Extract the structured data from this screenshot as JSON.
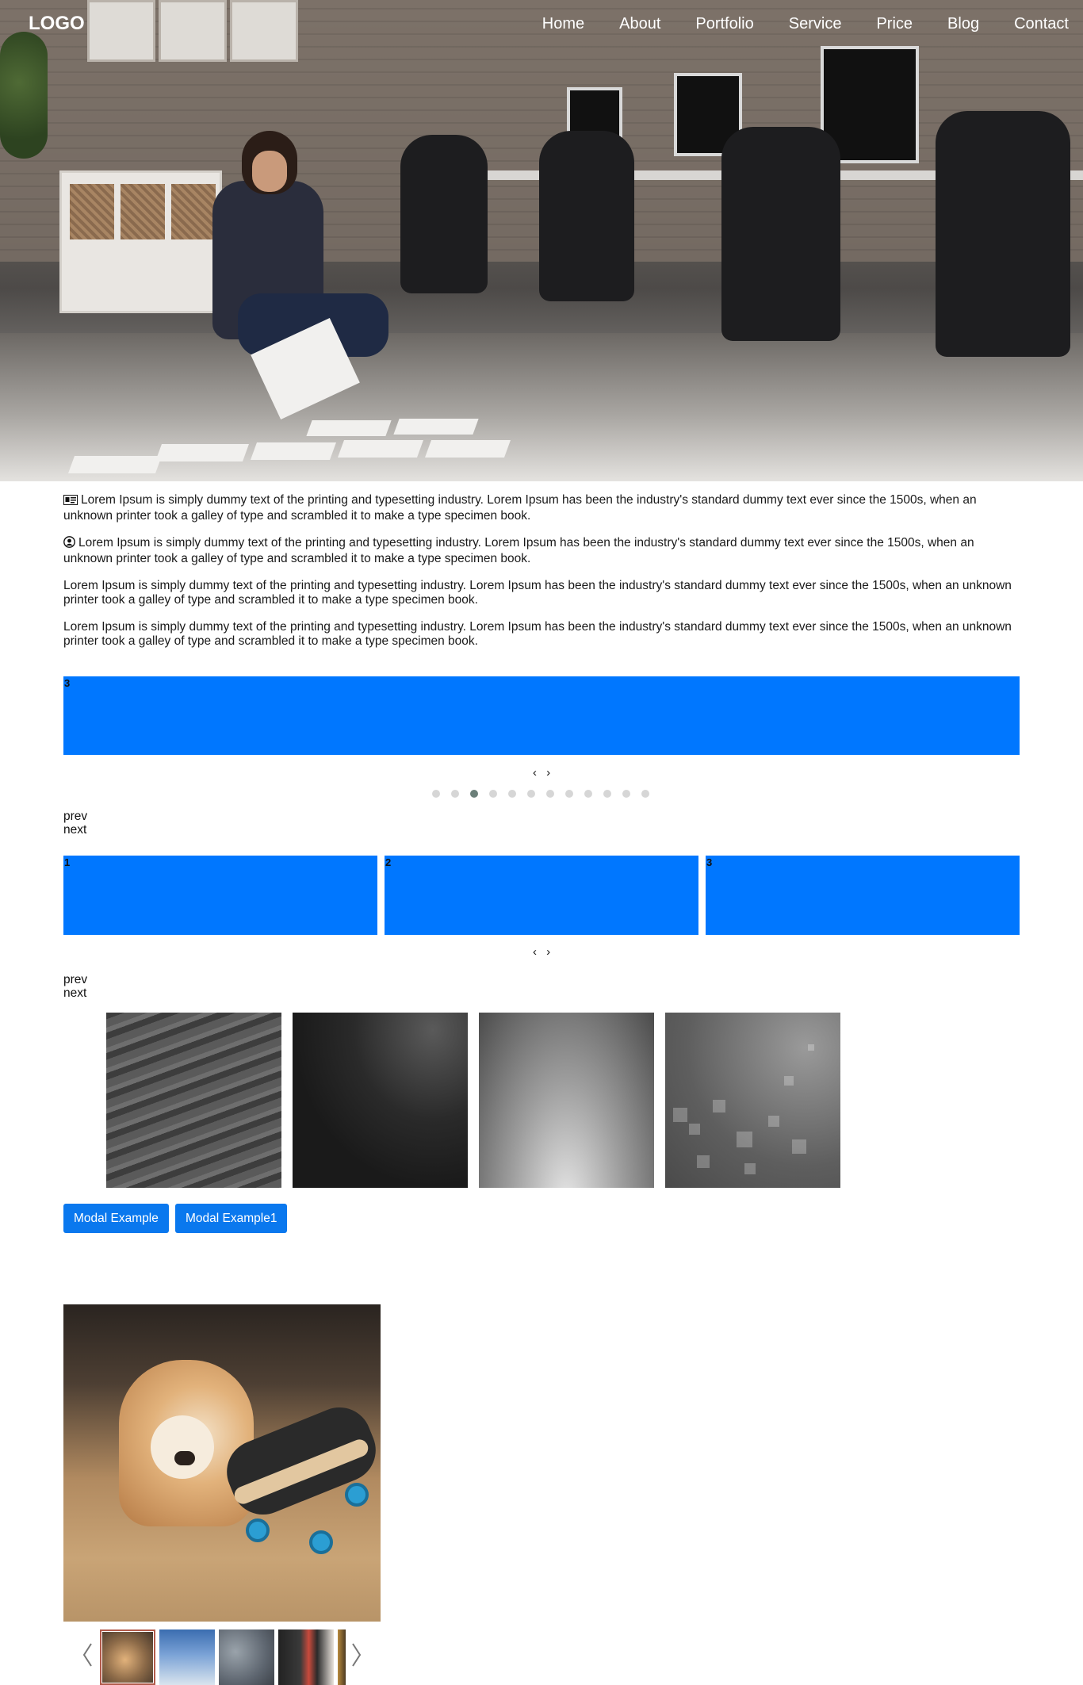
{
  "nav": {
    "logo": "LOGO",
    "items": [
      "Home",
      "About",
      "Portfolio",
      "Service",
      "Price",
      "Blog",
      "Contact"
    ]
  },
  "paragraphs": [
    {
      "icon": "id-card-icon",
      "text": "Lorem Ipsum is simply dummy text of the printing and typesetting industry. Lorem Ipsum has been the industry's standard dummy text ever since the 1500s, when an unknown printer took a galley of type and scrambled it to make a type specimen book."
    },
    {
      "icon": "user-circle-icon",
      "text": "Lorem Ipsum is simply dummy text of the printing and typesetting industry. Lorem Ipsum has been the industry's standard dummy text ever since the 1500s, when an unknown printer took a galley of type and scrambled it to make a type specimen book."
    },
    {
      "icon": "",
      "text": "Lorem Ipsum is simply dummy text of the printing and typesetting industry. Lorem Ipsum has been the industry's standard dummy text ever since the 1500s, when an unknown printer took a galley of type and scrambled it to make a type specimen book."
    },
    {
      "icon": "",
      "text": "Lorem Ipsum is simply dummy text of the printing and typesetting industry. Lorem Ipsum has been the industry's standard dummy text ever since the 1500s, when an unknown printer took a galley of type and scrambled it to make a type specimen book."
    }
  ],
  "slider_single": {
    "current_slide": "3",
    "arrows": "‹ ›",
    "dot_count": 12,
    "active_dot": 2,
    "prev": "prev",
    "next": "next"
  },
  "slider_multi": {
    "slides": [
      "1",
      "2",
      "3"
    ],
    "arrows": "‹ ›",
    "prev": "prev",
    "next": "next"
  },
  "buttons": {
    "modal1": "Modal Example",
    "modal2": "Modal Example1"
  },
  "colors": {
    "slide_blue": "#0077ff",
    "button_blue": "#0a78ee",
    "dot_active": "#6b7f79",
    "dot_inactive": "#d6d6d6"
  }
}
